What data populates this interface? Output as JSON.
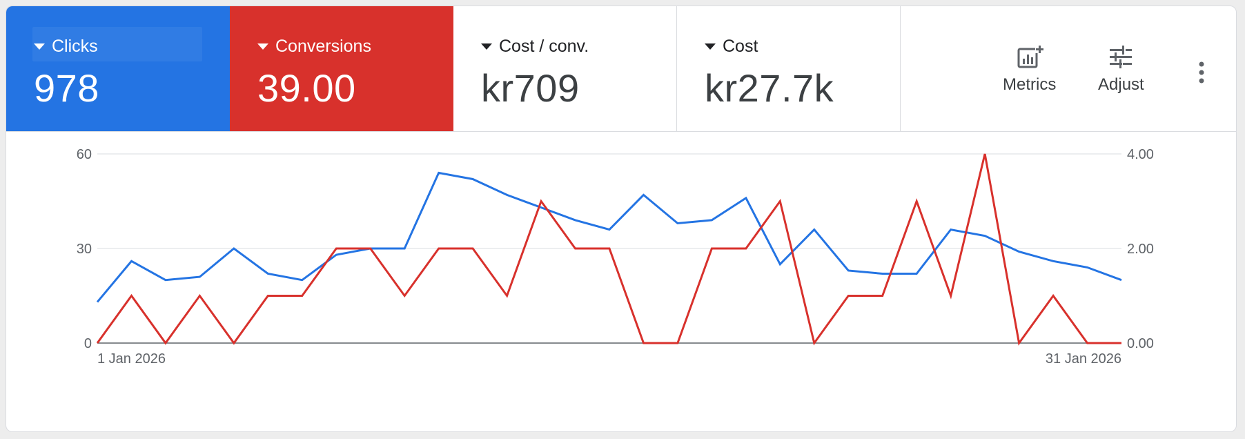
{
  "scorecards": [
    {
      "label": "Clicks",
      "value": "978",
      "color": "#2474e3",
      "active": true
    },
    {
      "label": "Conversions",
      "value": "39.00",
      "color": "#d8312c",
      "active": true
    },
    {
      "label": "Cost / conv.",
      "value": "kr709",
      "active": false
    },
    {
      "label": "Cost",
      "value": "kr27.7k",
      "active": false
    }
  ],
  "toolbar": {
    "metrics_label": "Metrics",
    "adjust_label": "Adjust",
    "metrics_icon": "add-chart-icon",
    "adjust_icon": "tune-icon",
    "more_icon": "more-vert-icon"
  },
  "chart_data": {
    "type": "line",
    "x_start_label": "1 Jan 2026",
    "x_end_label": "31 Jan 2026",
    "y_left_ticks": [
      "0",
      "30",
      "60"
    ],
    "y_right_ticks": [
      "0.00",
      "2.00",
      "4.00"
    ],
    "y_left_lim": [
      0,
      60
    ],
    "y_right_lim": [
      0,
      4
    ],
    "grid": true,
    "series": [
      {
        "name": "Clicks",
        "axis": "left",
        "color": "#2474e3",
        "values": [
          13,
          26,
          20,
          21,
          30,
          22,
          20,
          28,
          30,
          30,
          54,
          52,
          47,
          43,
          39,
          36,
          47,
          38,
          39,
          46,
          25,
          36,
          23,
          22,
          22,
          36,
          34,
          29,
          26,
          24,
          20
        ]
      },
      {
        "name": "Conversions",
        "axis": "right",
        "color": "#d8312c",
        "values": [
          0,
          1,
          0,
          1,
          0,
          1,
          1,
          2,
          2,
          1,
          2,
          2,
          1,
          3,
          2,
          2,
          0,
          0,
          2,
          2,
          3,
          0,
          1,
          1,
          3,
          1,
          4,
          0,
          1,
          0,
          0
        ]
      }
    ]
  }
}
